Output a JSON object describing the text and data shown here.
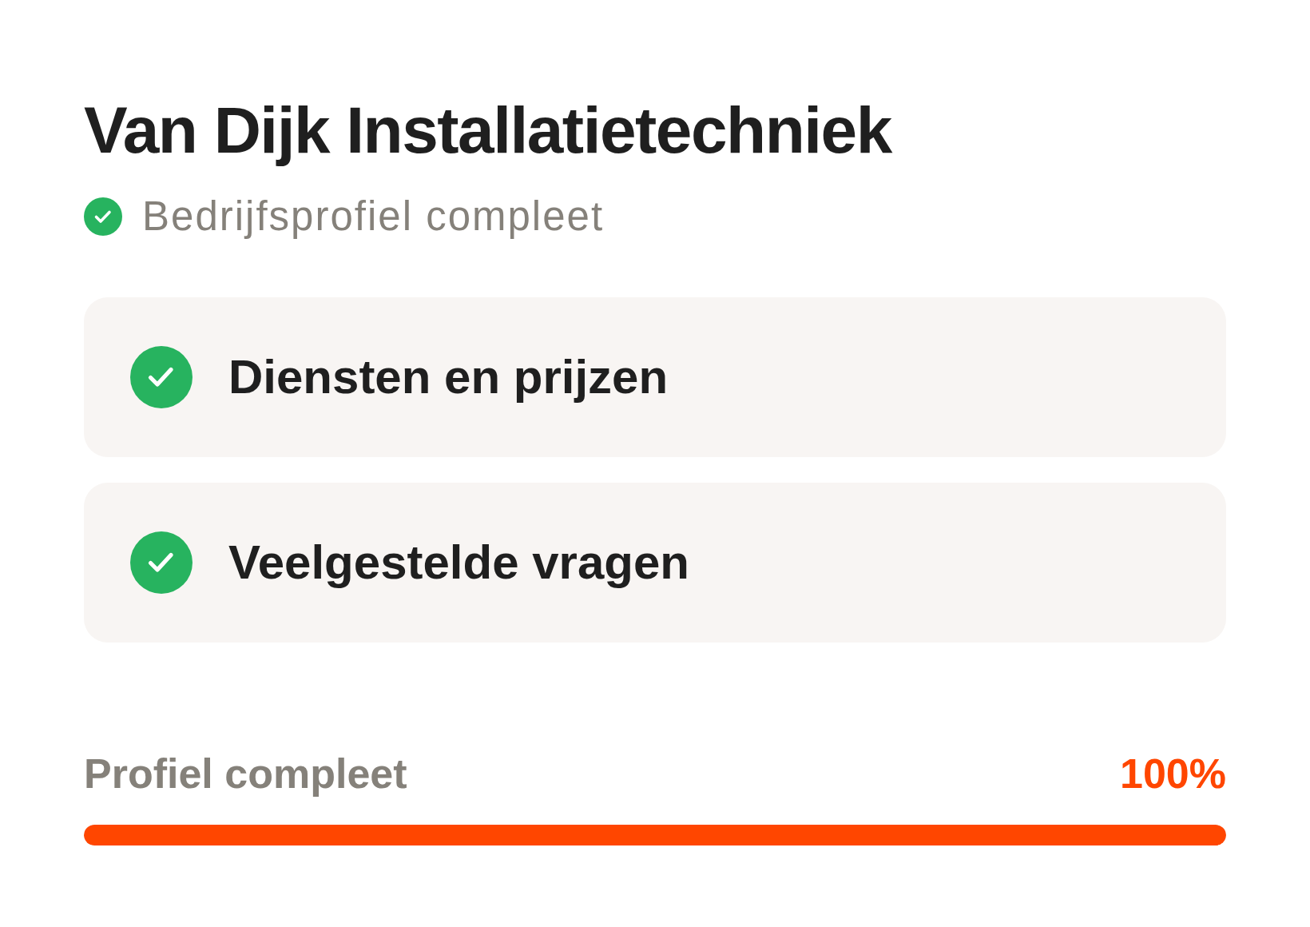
{
  "title": "Van Dijk Installatietechniek",
  "status": {
    "label": "Bedrijfsprofiel compleet",
    "complete": true
  },
  "sections": [
    {
      "label": "Diensten en prijzen",
      "complete": true
    },
    {
      "label": "Veelgestelde vragen",
      "complete": true
    }
  ],
  "progress": {
    "label": "Profiel compleet",
    "reading": "100%",
    "level": 1
  }
}
